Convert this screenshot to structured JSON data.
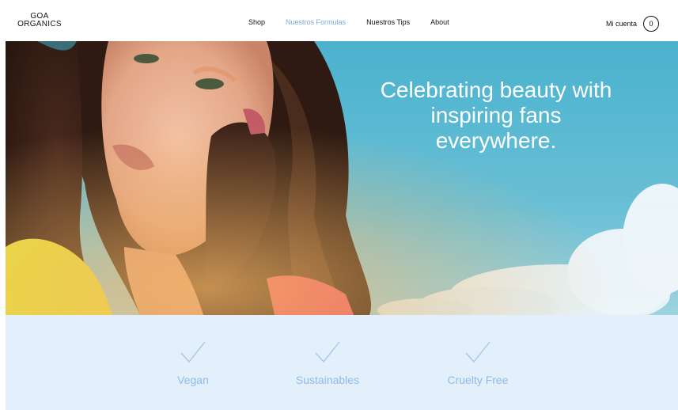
{
  "brand": {
    "logo_line1": "GOA",
    "logo_line2": "ORGANICS"
  },
  "nav": {
    "items": [
      {
        "label": "Shop",
        "active": false
      },
      {
        "label": "Nuestros Formulas",
        "active": true
      },
      {
        "label": "Nuestros Tips",
        "active": false
      },
      {
        "label": "About",
        "active": false
      }
    ]
  },
  "account": {
    "label": "Mi cuenta",
    "cart_count": "0"
  },
  "hero": {
    "title_line1": "Celebrating beauty with",
    "title_line2": "inspiring fans",
    "title_line3": "everywhere."
  },
  "features": [
    {
      "label": "Vegan",
      "icon": "check-icon"
    },
    {
      "label": "Sustainables",
      "icon": "check-icon"
    },
    {
      "label": "Cruelty Free",
      "icon": "check-icon"
    }
  ],
  "colors": {
    "accent": "#7fa9dd",
    "feature_text": "#8fbbe8",
    "features_bg": "#e3effa",
    "sky": "#62bdd5"
  }
}
